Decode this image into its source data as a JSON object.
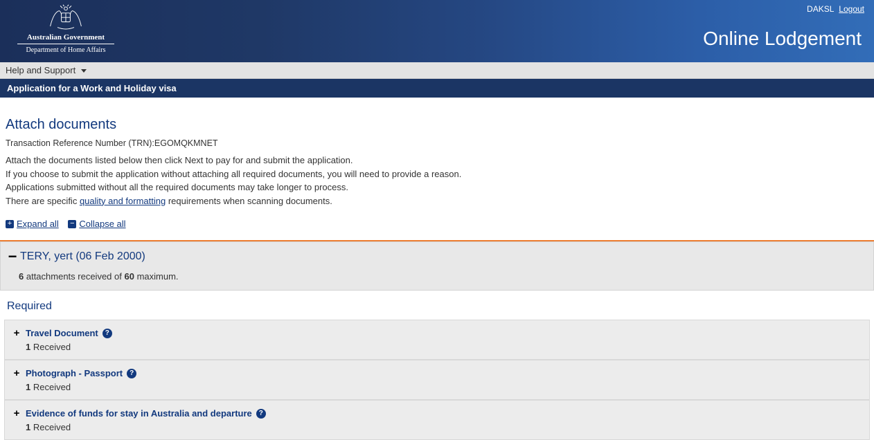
{
  "header": {
    "user": "DAKSL",
    "logout": "Logout",
    "gov_line1": "Australian Government",
    "gov_line2": "Department of Home Affairs",
    "app_brand": "Online Lodgement"
  },
  "menubar": {
    "help_label": "Help and Support"
  },
  "app_title": "Application for a Work and Holiday visa",
  "page": {
    "heading": "Attach documents",
    "trn_prefix": "Transaction Reference Number (TRN):",
    "trn_value": "EGOMQKMNET",
    "instructions_line1": "Attach the documents listed below then click Next to pay for and submit the application.",
    "instructions_line2": "If you choose to submit the application without attaching all required documents, you will need to provide a reason.",
    "instructions_line3": "Applications submitted without all the required documents may take longer to process.",
    "instructions_line4_pre": "There are specific ",
    "instructions_line4_link": "quality and formatting",
    "instructions_line4_post": " requirements when scanning documents.",
    "expand_all": "Expand all",
    "collapse_all": "Collapse all"
  },
  "applicant": {
    "name": "TERY, yert (06 Feb 2000)",
    "count_received": "6",
    "count_mid": " attachments received of ",
    "count_max": "60",
    "count_suffix": " maximum."
  },
  "sections": {
    "required_heading": "Required",
    "received_label": " Received",
    "docs": [
      {
        "title": "Travel Document",
        "received": "1"
      },
      {
        "title": "Photograph - Passport",
        "received": "1"
      },
      {
        "title": "Evidence of funds for stay in Australia and departure",
        "received": "1"
      }
    ]
  }
}
